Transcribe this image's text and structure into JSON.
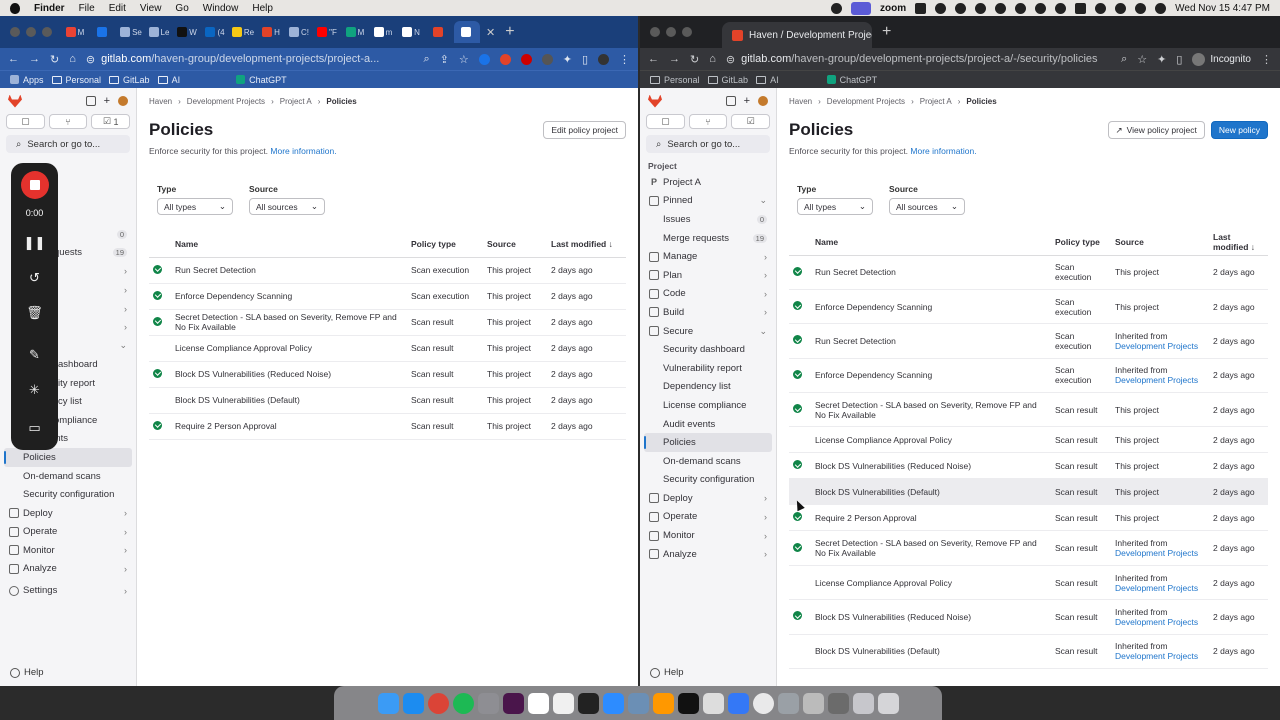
{
  "menubar": {
    "app": "Finder",
    "menus": [
      "File",
      "Edit",
      "View",
      "Go",
      "Window",
      "Help"
    ],
    "zoom_label": "zoom",
    "datetime": "Wed Nov 15  4:47 PM"
  },
  "left_browser": {
    "tabs": [
      {
        "letter": "M",
        "label": ""
      },
      {
        "letter": "",
        "label": ""
      },
      {
        "letter": "",
        "label": "Se"
      },
      {
        "letter": "",
        "label": "Le"
      },
      {
        "letter": "F",
        "label": "W"
      },
      {
        "letter": "in",
        "label": "(4"
      },
      {
        "letter": "",
        "label": "Re"
      },
      {
        "letter": "",
        "label": "H"
      },
      {
        "letter": "",
        "label": "C!"
      },
      {
        "letter": "",
        "label": "\"F"
      },
      {
        "letter": "",
        "label": "M"
      },
      {
        "letter": "",
        "label": "m"
      },
      {
        "letter": "",
        "label": "N"
      },
      {
        "letter": "",
        "label": ""
      }
    ],
    "url_host": "gitlab.com",
    "url_path": "/haven-group/development-projects/project-a...",
    "bookmarks": [
      "Apps",
      "Personal",
      "GitLab",
      "AI",
      "ChatGPT"
    ],
    "sidebar": {
      "counter_mr": "1",
      "search": "Search or go to...",
      "items": [
        {
          "label": "",
          "badge": "0"
        },
        {
          "label": "quests",
          "badge": "19"
        },
        {
          "label": "ashboard"
        },
        {
          "label": "ity report"
        },
        {
          "label": "cy list"
        },
        {
          "label": "ompliance"
        },
        {
          "label": "events"
        },
        {
          "label": "Policies"
        },
        {
          "label": "On-demand scans"
        },
        {
          "label": "Security configuration"
        },
        {
          "label": "Deploy"
        },
        {
          "label": "Operate"
        },
        {
          "label": "Monitor"
        },
        {
          "label": "Analyze"
        },
        {
          "label": "Settings"
        }
      ],
      "help": "Help"
    },
    "main": {
      "breadcrumbs": [
        "Haven",
        "Development Projects",
        "Project A",
        "Policies"
      ],
      "title": "Policies",
      "edit_button": "Edit policy project",
      "subtitle": "Enforce security for this project.",
      "more_info": "More information.",
      "type_label": "Type",
      "type_value": "All types",
      "source_label": "Source",
      "source_value": "All sources",
      "columns": [
        "Name",
        "Policy type",
        "Source",
        "Last modified"
      ],
      "rows": [
        {
          "status": true,
          "name": "Run Secret Detection",
          "type": "Scan execution",
          "source": "This project",
          "modified": "2 days ago"
        },
        {
          "status": true,
          "name": "Enforce Dependency Scanning",
          "type": "Scan execution",
          "source": "This project",
          "modified": "2 days ago"
        },
        {
          "status": true,
          "name": "Secret Detection - SLA based on Severity, Remove FP and No Fix Available",
          "type": "Scan result",
          "source": "This project",
          "modified": "2 days ago"
        },
        {
          "status": false,
          "name": "License Compliance Approval Policy",
          "type": "Scan result",
          "source": "This project",
          "modified": "2 days ago"
        },
        {
          "status": true,
          "name": "Block DS Vulnerabilities (Reduced Noise)",
          "type": "Scan result",
          "source": "This project",
          "modified": "2 days ago"
        },
        {
          "status": false,
          "name": "Block DS Vulnerabilities (Default)",
          "type": "Scan result",
          "source": "This project",
          "modified": "2 days ago"
        },
        {
          "status": true,
          "name": "Require 2 Person Approval",
          "type": "Scan result",
          "source": "This project",
          "modified": "2 days ago"
        }
      ]
    }
  },
  "right_browser": {
    "tab_title": "Haven / Development Projects",
    "url_host": "gitlab.com",
    "url_path": "/haven-group/development-projects/project-a/-/security/policies",
    "incognito": "Incognito",
    "bookmarks": [
      "Personal",
      "GitLab",
      "AI",
      "ChatGPT"
    ],
    "sidebar": {
      "search": "Search or go to...",
      "section": "Project",
      "items": [
        {
          "icon": "P",
          "label": "Project A"
        },
        {
          "label": "Pinned",
          "chev": "⌄"
        },
        {
          "label": "Issues",
          "badge": "0",
          "sub": true
        },
        {
          "label": "Merge requests",
          "badge": "19",
          "sub": true
        },
        {
          "label": "Manage",
          "chev": "›"
        },
        {
          "label": "Plan",
          "chev": "›"
        },
        {
          "label": "Code",
          "chev": "›"
        },
        {
          "label": "Build",
          "chev": "›"
        },
        {
          "label": "Secure",
          "chev": "⌄"
        },
        {
          "label": "Security dashboard",
          "sub": true
        },
        {
          "label": "Vulnerability report",
          "sub": true
        },
        {
          "label": "Dependency list",
          "sub": true
        },
        {
          "label": "License compliance",
          "sub": true
        },
        {
          "label": "Audit events",
          "sub": true
        },
        {
          "label": "Policies",
          "sub": true,
          "active": true
        },
        {
          "label": "On-demand scans",
          "sub": true
        },
        {
          "label": "Security configuration",
          "sub": true
        },
        {
          "label": "Deploy",
          "chev": "›"
        },
        {
          "label": "Operate",
          "chev": "›"
        },
        {
          "label": "Monitor",
          "chev": "›"
        },
        {
          "label": "Analyze",
          "chev": "›"
        }
      ],
      "help": "Help"
    },
    "main": {
      "breadcrumbs": [
        "Haven",
        "Development Projects",
        "Project A",
        "Policies"
      ],
      "title": "Policies",
      "view_button": "View policy project",
      "new_button": "New policy",
      "subtitle": "Enforce security for this project.",
      "more_info": "More information.",
      "type_label": "Type",
      "type_value": "All types",
      "source_label": "Source",
      "source_value": "All sources",
      "columns": [
        "Name",
        "Policy type",
        "Source",
        "Last modified"
      ],
      "rows": [
        {
          "status": true,
          "name": "Run Secret Detection",
          "type": "Scan execution",
          "source": "This project",
          "modified": "2 days ago"
        },
        {
          "status": true,
          "name": "Enforce Dependency Scanning",
          "type": "Scan execution",
          "source": "This project",
          "modified": "2 days ago"
        },
        {
          "status": true,
          "name": "Run Secret Detection",
          "type": "Scan execution",
          "source": "Inherited from",
          "source_link": "Development Projects",
          "modified": "2 days ago"
        },
        {
          "status": true,
          "name": "Enforce Dependency Scanning",
          "type": "Scan execution",
          "source": "Inherited from",
          "source_link": "Development Projects",
          "modified": "2 days ago"
        },
        {
          "status": true,
          "name": "Secret Detection - SLA based on Severity, Remove FP and No Fix Available",
          "type": "Scan result",
          "source": "This project",
          "modified": "2 days ago"
        },
        {
          "status": false,
          "name": "License Compliance Approval Policy",
          "type": "Scan result",
          "source": "This project",
          "modified": "2 days ago",
          "short": true
        },
        {
          "status": true,
          "name": "Block DS Vulnerabilities (Reduced Noise)",
          "type": "Scan result",
          "source": "This project",
          "modified": "2 days ago",
          "short": true
        },
        {
          "status": false,
          "name": "Block DS Vulnerabilities (Default)",
          "type": "Scan result",
          "source": "This project",
          "modified": "2 days ago",
          "short": true,
          "hover": true
        },
        {
          "status": true,
          "name": "Require 2 Person Approval",
          "type": "Scan result",
          "source": "This project",
          "modified": "2 days ago",
          "short": true
        },
        {
          "status": true,
          "name": "Secret Detection - SLA based on Severity, Remove FP and No Fix Available",
          "type": "Scan result",
          "source": "Inherited from",
          "source_link": "Development Projects",
          "modified": "2 days ago"
        },
        {
          "status": false,
          "name": "License Compliance Approval Policy",
          "type": "Scan result",
          "source": "Inherited from",
          "source_link": "Development Projects",
          "modified": "2 days ago"
        },
        {
          "status": true,
          "name": "Block DS Vulnerabilities (Reduced Noise)",
          "type": "Scan result",
          "source": "Inherited from",
          "source_link": "Development Projects",
          "modified": "2 days ago"
        },
        {
          "status": false,
          "name": "Block DS Vulnerabilities (Default)",
          "type": "Scan result",
          "source": "Inherited from",
          "source_link": "Development Projects",
          "modified": "2 days ago"
        }
      ]
    }
  },
  "recorder": {
    "time": "0:00"
  },
  "colors": {
    "gitlab_orange": "#e24329",
    "link_blue": "#1f75cb",
    "success_green": "#108548",
    "record_red": "#e5322d"
  }
}
